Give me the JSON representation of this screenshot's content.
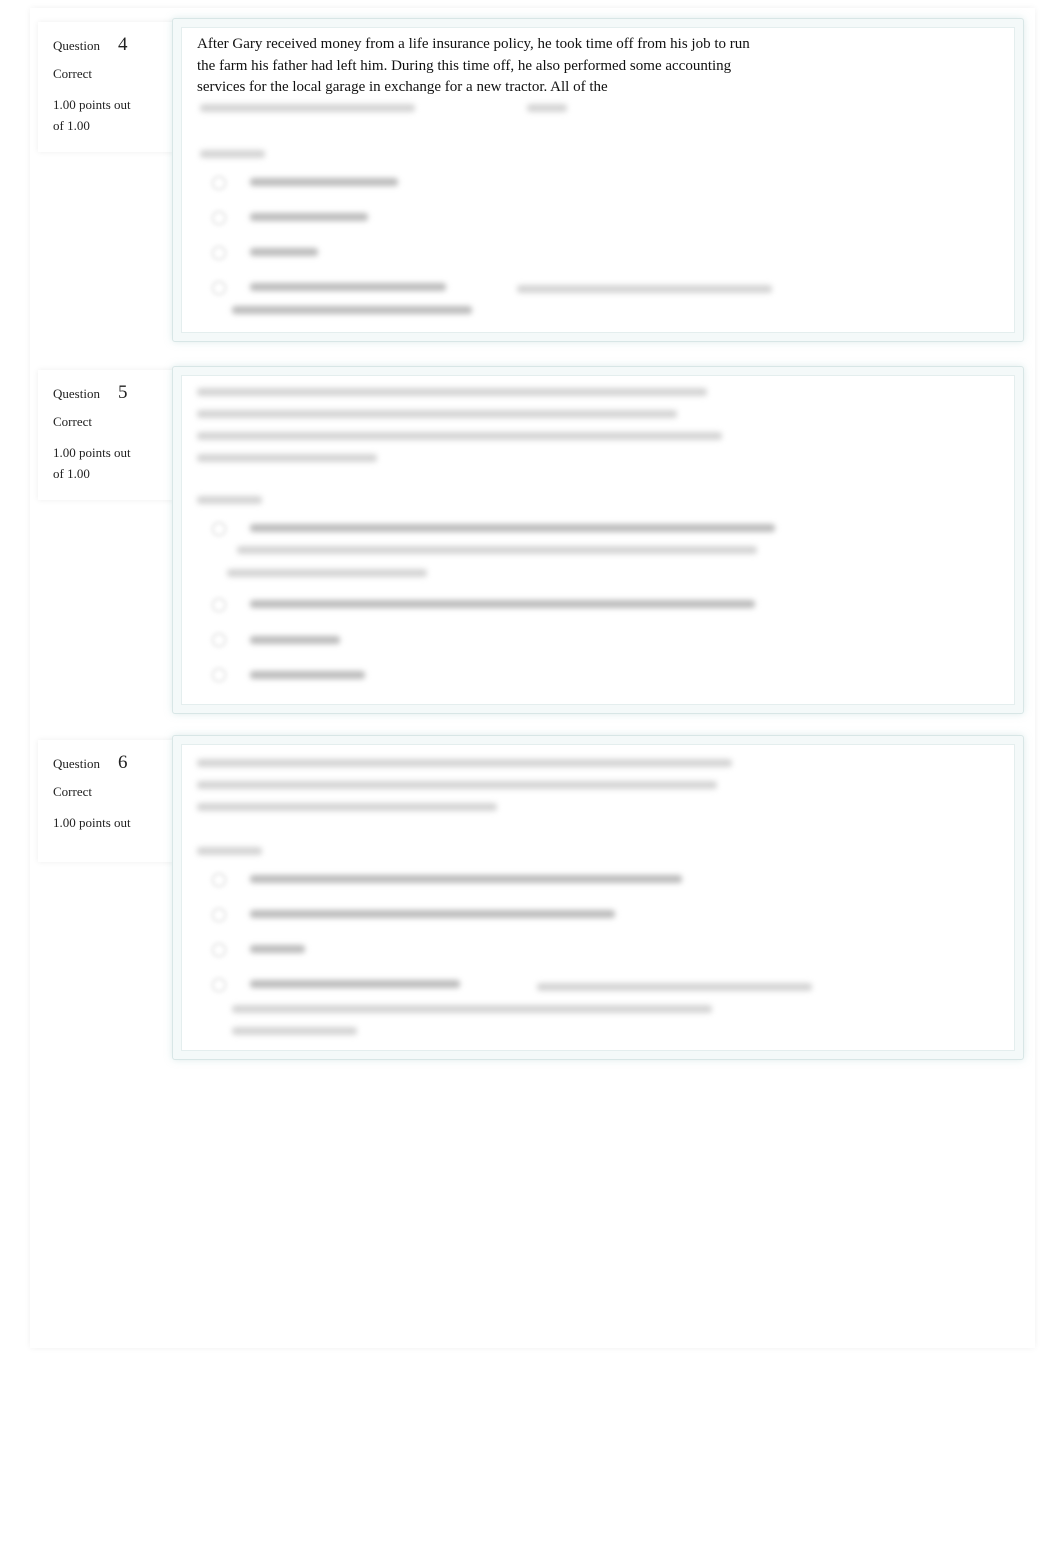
{
  "questions": [
    {
      "label": "Question",
      "number": "4",
      "status": "Correct",
      "points": "1.00 points out of 1.00",
      "text": "After Gary received money from a life insurance policy, he took time off from his job to run the farm his father had left him. During this time off, he also performed some accounting services for the local garage in exchange for a new tractor. All of the"
    },
    {
      "label": "Question",
      "number": "5",
      "status": "Correct",
      "points": "1.00 points out of 1.00"
    },
    {
      "label": "Question",
      "number": "6",
      "status": "Correct",
      "points": "1.00 points out"
    }
  ],
  "colors": {
    "box_border": "#d8e6e6",
    "box_bg": "#f4f9f9"
  }
}
